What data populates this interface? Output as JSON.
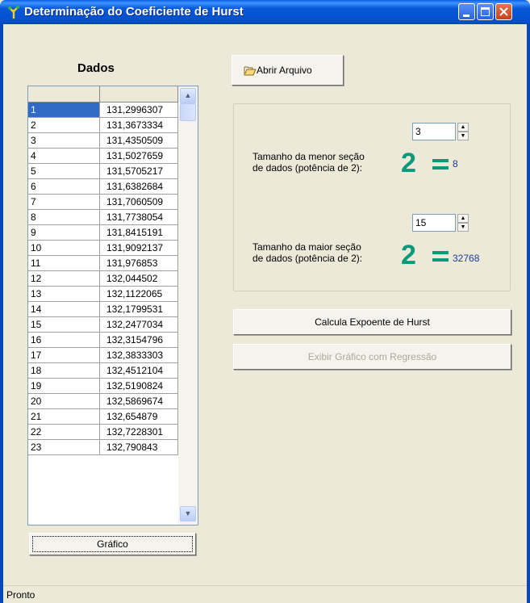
{
  "window": {
    "title": "Determinação do Coeficiente de Hurst"
  },
  "data_panel": {
    "title": "Dados",
    "header": [
      "",
      ""
    ],
    "rows": [
      {
        "index": "1",
        "value": "131,2996307"
      },
      {
        "index": "2",
        "value": "131,3673334"
      },
      {
        "index": "3",
        "value": "131,4350509"
      },
      {
        "index": "4",
        "value": "131,5027659"
      },
      {
        "index": "5",
        "value": "131,5705217"
      },
      {
        "index": "6",
        "value": "131,6382684"
      },
      {
        "index": "7",
        "value": "131,7060509"
      },
      {
        "index": "8",
        "value": "131,7738054"
      },
      {
        "index": "9",
        "value": "131,8415191"
      },
      {
        "index": "10",
        "value": "131,9092137"
      },
      {
        "index": "11",
        "value": "131,976853"
      },
      {
        "index": "12",
        "value": "132,044502"
      },
      {
        "index": "13",
        "value": "132,1122065"
      },
      {
        "index": "14",
        "value": "132,1799531"
      },
      {
        "index": "15",
        "value": "132,2477034"
      },
      {
        "index": "16",
        "value": "132,3154796"
      },
      {
        "index": "17",
        "value": "132,3833303"
      },
      {
        "index": "18",
        "value": "132,4512104"
      },
      {
        "index": "19",
        "value": "132,5190824"
      },
      {
        "index": "20",
        "value": "132,5869674"
      },
      {
        "index": "21",
        "value": "132,654879"
      },
      {
        "index": "22",
        "value": "132,7228301"
      },
      {
        "index": "23",
        "value": "132,790843"
      }
    ],
    "chart_button": "Gráfico"
  },
  "toolbar": {
    "open_file": "Abrir Arquivo"
  },
  "settings": {
    "min_label_line1": "Tamanho da menor seção",
    "min_label_line2": "de dados (potência de 2):",
    "min_exponent": "3",
    "min_result": "8",
    "max_label_line1": "Tamanho da maior seção",
    "max_label_line2": "de dados (potência de 2):",
    "max_exponent": "15",
    "max_result": "32768",
    "base": "2"
  },
  "actions": {
    "calculate": "Calcula Expoente de Hurst",
    "show_chart": "Exibir Gráfico com Regressão"
  },
  "status": {
    "text": "Pronto"
  }
}
